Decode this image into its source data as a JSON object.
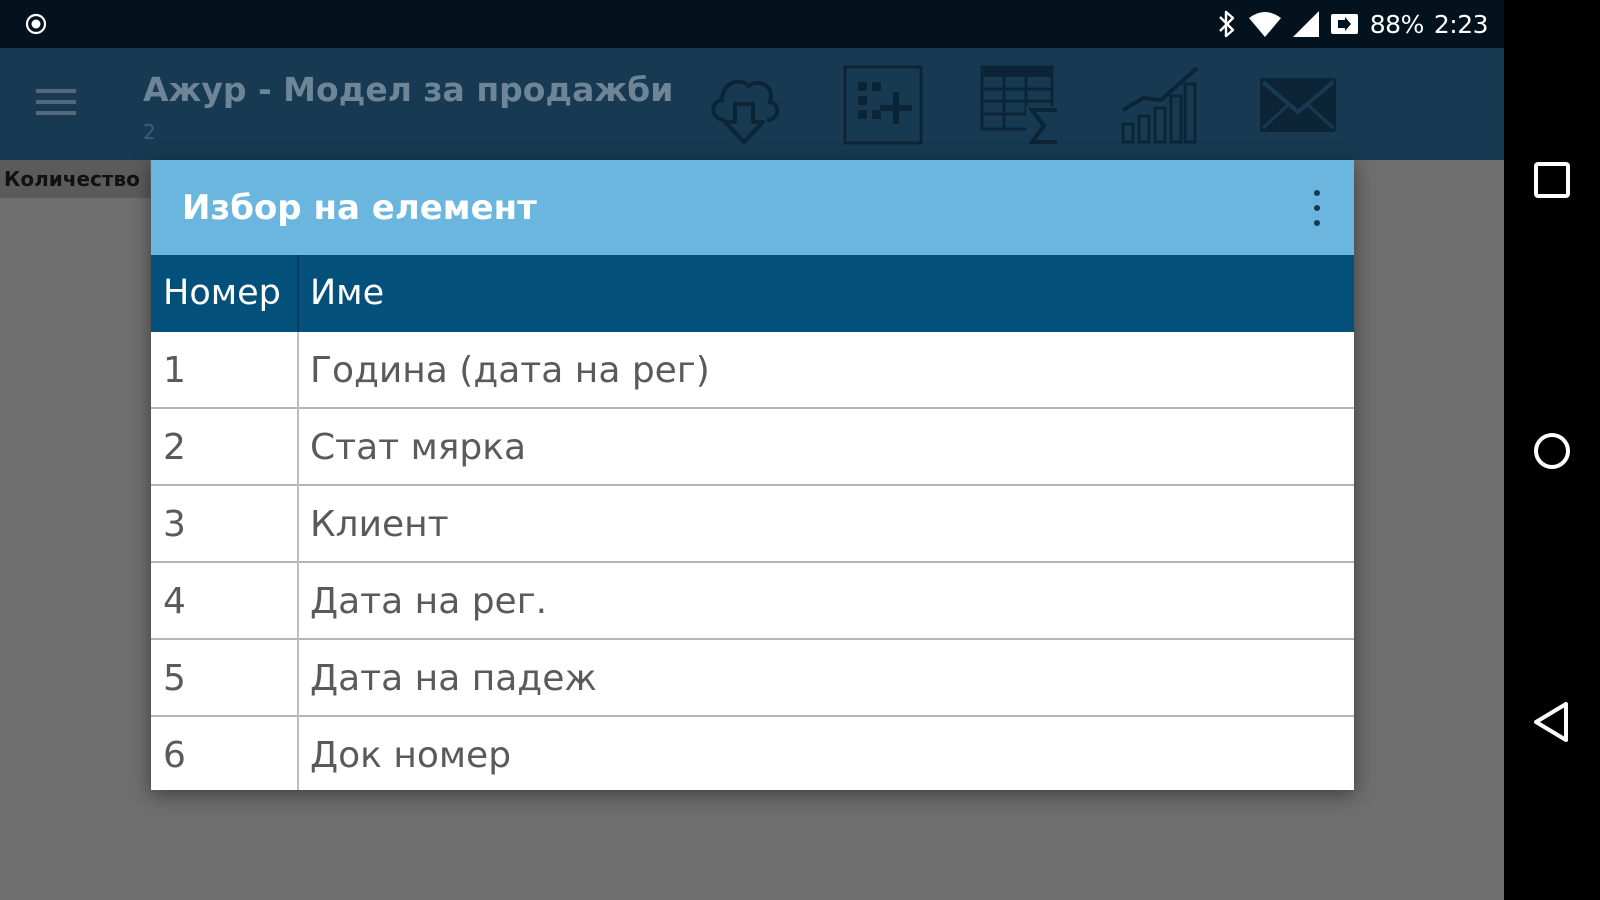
{
  "status_bar": {
    "battery": "88%",
    "time": "2:23",
    "icons": [
      "record-icon",
      "bluetooth-icon",
      "wifi-icon",
      "signal-icon",
      "battery-icon"
    ]
  },
  "app_bar": {
    "title": "Ажур - Модел за продажби",
    "subtitle": "2",
    "actions": [
      "cloud-download-icon",
      "add-grid-icon",
      "table-sum-icon",
      "bar-chart-icon",
      "mail-icon"
    ]
  },
  "background": {
    "column_tab": "Количество"
  },
  "dialog": {
    "title": "Избор на елемент",
    "columns": {
      "number": "Номер",
      "name": "Име"
    },
    "rows": [
      {
        "number": "1",
        "name": "Година (дата на рег)"
      },
      {
        "number": "2",
        "name": "Стат мярка"
      },
      {
        "number": "3",
        "name": "Клиент"
      },
      {
        "number": "4",
        "name": "Дата на рег."
      },
      {
        "number": "5",
        "name": "Дата на падеж"
      },
      {
        "number": "6",
        "name": "Док номер"
      }
    ]
  },
  "nav_bar": [
    "recents-icon",
    "home-icon",
    "back-icon"
  ],
  "colors": {
    "status_bar": "#03121c",
    "app_bar": "#173a52",
    "dialog_header": "#6bb6de",
    "table_header": "#03507a",
    "scrim": "#6e6e6e"
  }
}
